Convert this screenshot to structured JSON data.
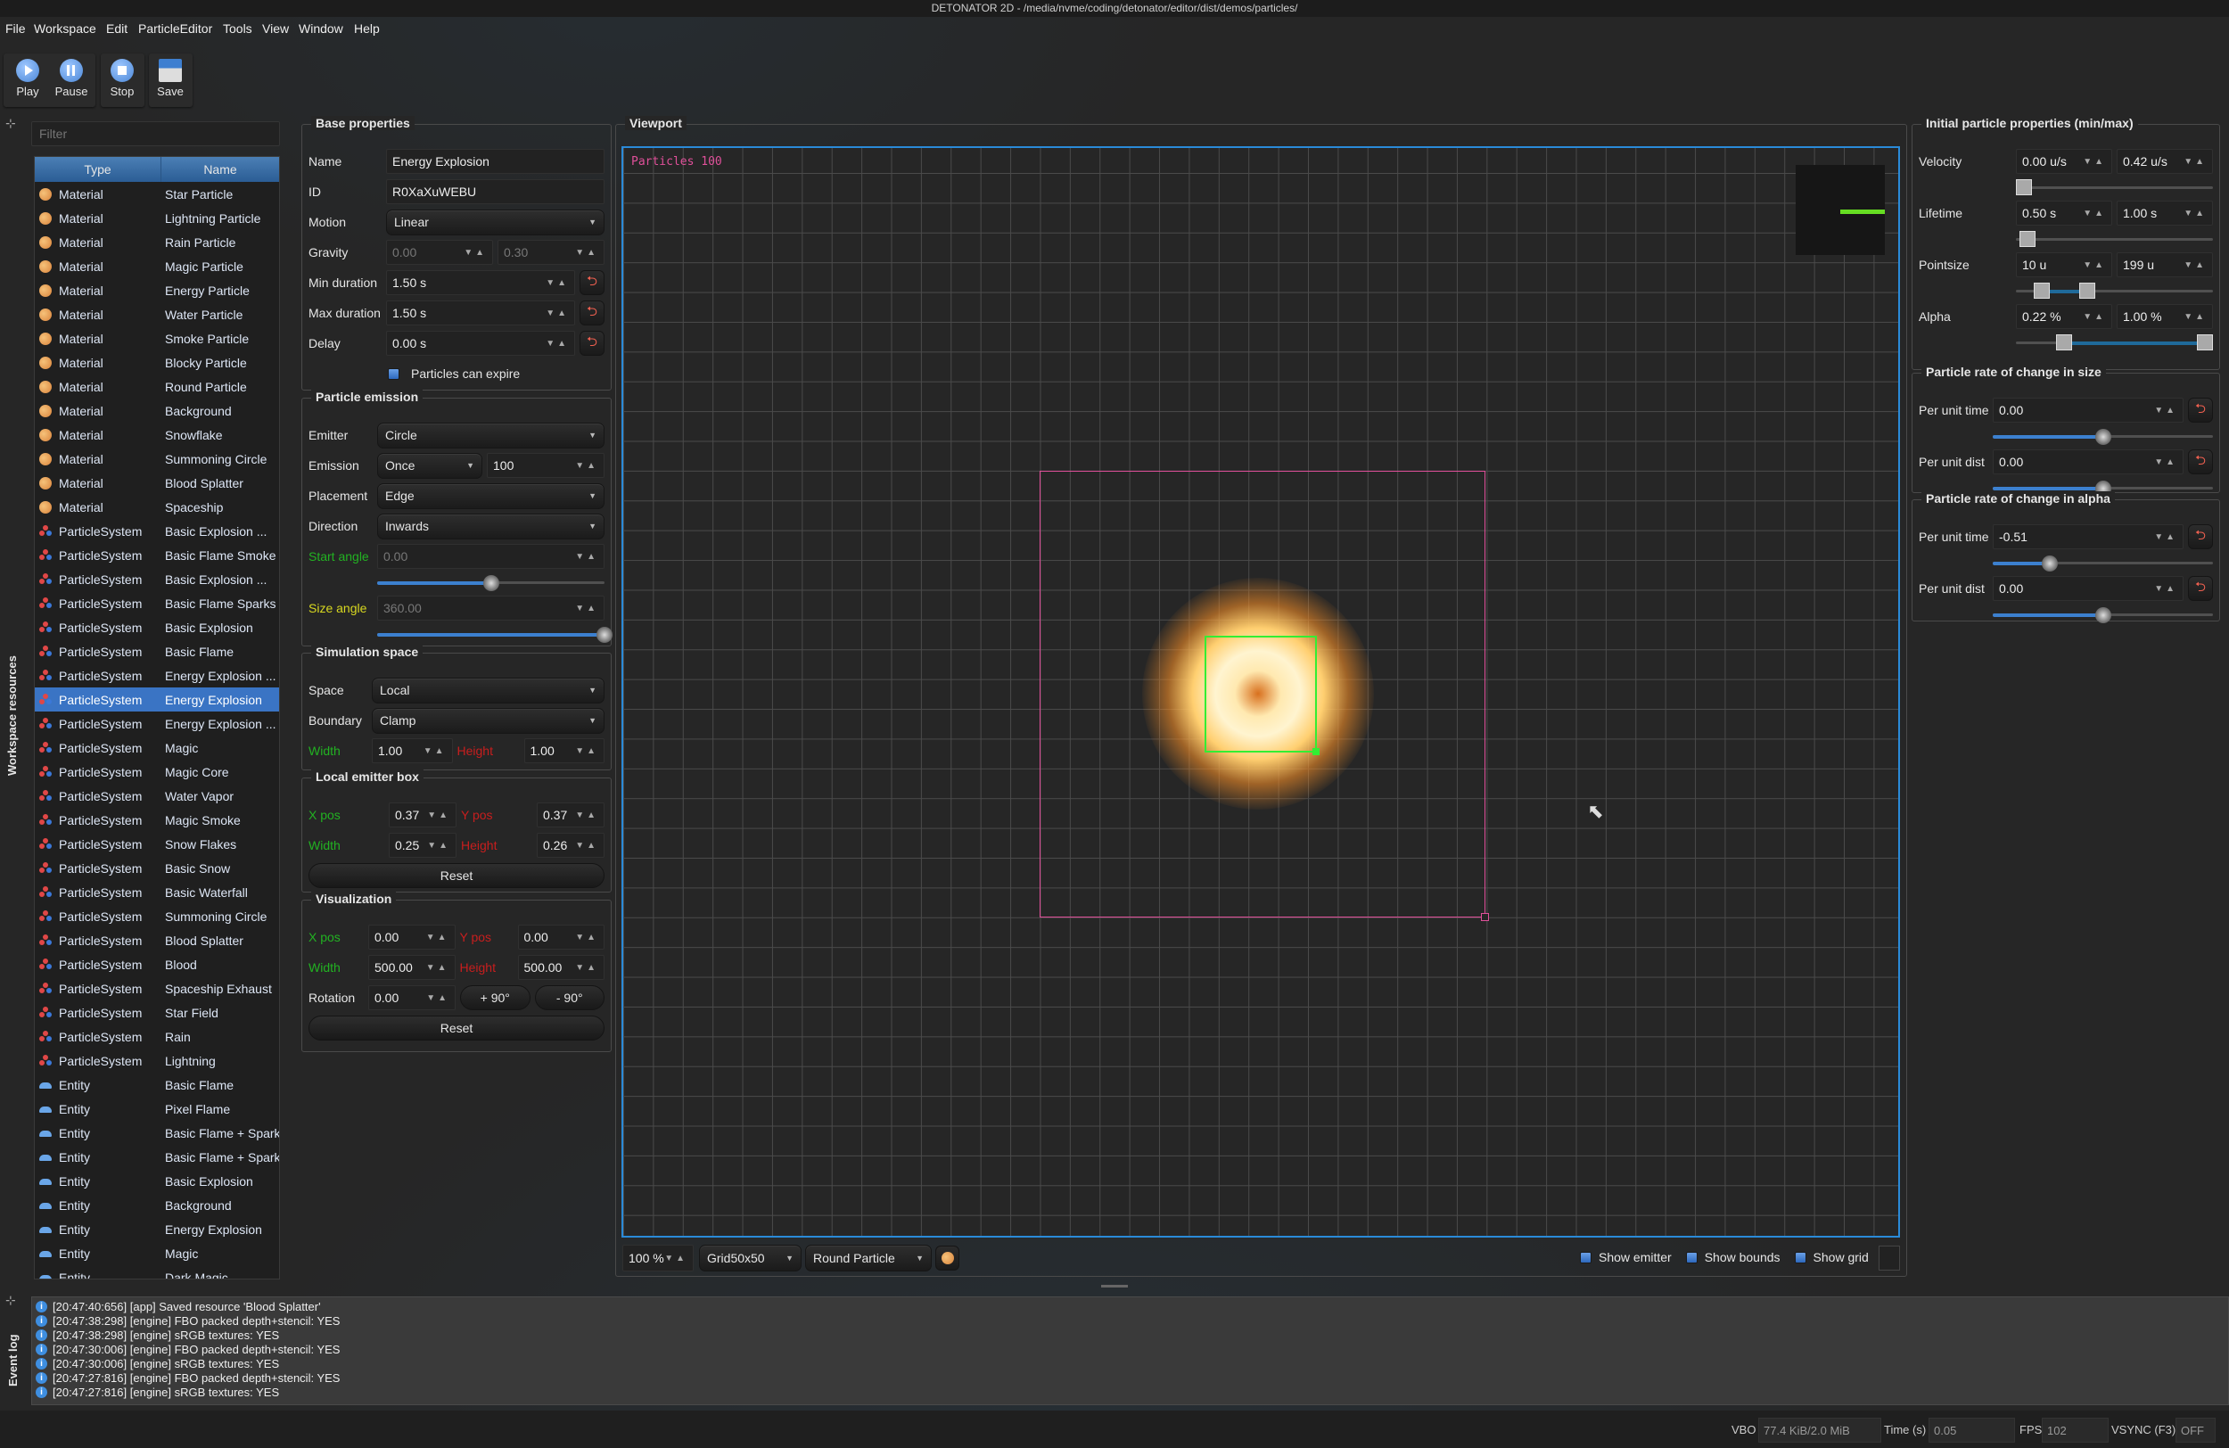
{
  "window_title": "DETONATOR 2D - /media/nvme/coding/detonator/editor/dist/demos/particles/",
  "menu": [
    "File",
    "Workspace",
    "Edit",
    "ParticleEditor",
    "Tools",
    "View",
    "Window",
    "Help"
  ],
  "toolbar": {
    "play": "Play",
    "pause": "Pause",
    "stop": "Stop",
    "save": "Save"
  },
  "resources": {
    "tab_label": "Workspace resources",
    "filter_placeholder": "Filter",
    "columns": [
      "Type",
      "Name"
    ],
    "selected_index": 21,
    "rows": [
      {
        "type": "Material",
        "name": "Star Particle"
      },
      {
        "type": "Material",
        "name": "Lightning Particle"
      },
      {
        "type": "Material",
        "name": "Rain Particle"
      },
      {
        "type": "Material",
        "name": "Magic Particle"
      },
      {
        "type": "Material",
        "name": "Energy Particle"
      },
      {
        "type": "Material",
        "name": "Water Particle"
      },
      {
        "type": "Material",
        "name": "Smoke Particle"
      },
      {
        "type": "Material",
        "name": "Blocky Particle"
      },
      {
        "type": "Material",
        "name": "Round Particle"
      },
      {
        "type": "Material",
        "name": "Background"
      },
      {
        "type": "Material",
        "name": "Snowflake"
      },
      {
        "type": "Material",
        "name": "Summoning Circle"
      },
      {
        "type": "Material",
        "name": "Blood Splatter"
      },
      {
        "type": "Material",
        "name": "Spaceship"
      },
      {
        "type": "ParticleSystem",
        "name": "Basic Explosion ..."
      },
      {
        "type": "ParticleSystem",
        "name": "Basic Flame Smoke"
      },
      {
        "type": "ParticleSystem",
        "name": "Basic Explosion ..."
      },
      {
        "type": "ParticleSystem",
        "name": "Basic Flame Sparks"
      },
      {
        "type": "ParticleSystem",
        "name": "Basic Explosion"
      },
      {
        "type": "ParticleSystem",
        "name": "Basic Flame"
      },
      {
        "type": "ParticleSystem",
        "name": "Energy Explosion ..."
      },
      {
        "type": "ParticleSystem",
        "name": "Energy Explosion"
      },
      {
        "type": "ParticleSystem",
        "name": "Energy Explosion ..."
      },
      {
        "type": "ParticleSystem",
        "name": "Magic"
      },
      {
        "type": "ParticleSystem",
        "name": "Magic Core"
      },
      {
        "type": "ParticleSystem",
        "name": "Water Vapor"
      },
      {
        "type": "ParticleSystem",
        "name": "Magic Smoke"
      },
      {
        "type": "ParticleSystem",
        "name": "Snow Flakes"
      },
      {
        "type": "ParticleSystem",
        "name": "Basic Snow"
      },
      {
        "type": "ParticleSystem",
        "name": "Basic Waterfall"
      },
      {
        "type": "ParticleSystem",
        "name": "Summoning Circle"
      },
      {
        "type": "ParticleSystem",
        "name": "Blood Splatter"
      },
      {
        "type": "ParticleSystem",
        "name": "Blood"
      },
      {
        "type": "ParticleSystem",
        "name": "Spaceship Exhaust"
      },
      {
        "type": "ParticleSystem",
        "name": "Star Field"
      },
      {
        "type": "ParticleSystem",
        "name": "Rain"
      },
      {
        "type": "ParticleSystem",
        "name": "Lightning"
      },
      {
        "type": "Entity",
        "name": "Basic Flame"
      },
      {
        "type": "Entity",
        "name": "Pixel Flame"
      },
      {
        "type": "Entity",
        "name": "Basic Flame + Spark.."
      },
      {
        "type": "Entity",
        "name": "Basic Flame + Sparks"
      },
      {
        "type": "Entity",
        "name": "Basic Explosion"
      },
      {
        "type": "Entity",
        "name": "Background"
      },
      {
        "type": "Entity",
        "name": "Energy Explosion"
      },
      {
        "type": "Entity",
        "name": "Magic"
      },
      {
        "type": "Entity",
        "name": "Dark Magic"
      }
    ]
  },
  "colors": {
    "x_label": "#22b222",
    "y_label": "#c81e1e",
    "size_angle_label": "#d8d820",
    "accent": "#2a8ad8",
    "emitter_bounds": "#e0509a",
    "emitter_box": "#33ee33"
  },
  "groups": {
    "base_properties": {
      "title": "Base properties",
      "rows": [
        {
          "kind": "text",
          "label": "Name",
          "value": "Energy Explosion"
        },
        {
          "kind": "text",
          "label": "ID",
          "value": "R0XaXuWEBU"
        },
        {
          "kind": "combo",
          "label": "Motion",
          "value": "Linear"
        },
        {
          "kind": "spin2",
          "label": "Gravity",
          "values": [
            "0.00",
            "0.30"
          ],
          "disabled": true
        },
        {
          "kind": "spin",
          "label": "Min duration",
          "value": "1.50 s",
          "reset": true
        },
        {
          "kind": "spin",
          "label": "Max duration",
          "value": "1.50 s",
          "reset": true
        },
        {
          "kind": "spin",
          "label": "Delay",
          "value": "0.00 s",
          "reset": true
        },
        {
          "kind": "check",
          "label": "Particles can expire",
          "checked": true
        }
      ]
    },
    "particle_emission": {
      "title": "Particle emission",
      "rows": [
        {
          "kind": "combo",
          "label": "Emitter",
          "value": "Circle"
        },
        {
          "kind": "combospin",
          "label": "Emission",
          "combo": "Once",
          "value": "100"
        },
        {
          "kind": "combo",
          "label": "Placement",
          "value": "Edge"
        },
        {
          "kind": "combo",
          "label": "Direction",
          "value": "Inwards"
        },
        {
          "kind": "spin",
          "label": "Start angle",
          "value": "0.00",
          "disabled": true,
          "color": "x_label"
        },
        {
          "kind": "slider",
          "style": "knob",
          "fraction": 0.5
        },
        {
          "kind": "spin",
          "label": "Size angle",
          "value": "360.00",
          "disabled": true,
          "color": "size_angle_label"
        },
        {
          "kind": "slider",
          "style": "knob",
          "fraction": 1.0
        }
      ]
    },
    "simulation_space": {
      "title": "Simulation space",
      "rows": [
        {
          "kind": "combo",
          "label": "Space",
          "value": "Local"
        },
        {
          "kind": "combo",
          "label": "Boundary",
          "value": "Clamp"
        },
        {
          "kind": "pair",
          "label": "Width",
          "value": "1.00",
          "label2": "Height",
          "value2": "1.00"
        }
      ]
    },
    "local_emitter_box": {
      "title": "Local emitter box",
      "rows": [
        {
          "kind": "pair",
          "label": "X pos",
          "value": "0.37",
          "label2": "Y pos",
          "value2": "0.37"
        },
        {
          "kind": "pair",
          "label": "Width",
          "value": "0.25",
          "label2": "Height",
          "value2": "0.26"
        },
        {
          "kind": "button",
          "label": "Reset"
        }
      ]
    },
    "visualization": {
      "title": "Visualization",
      "rows": [
        {
          "kind": "pair",
          "label": "X pos",
          "value": "0.00",
          "label2": "Y pos",
          "value2": "0.00"
        },
        {
          "kind": "pair",
          "label": "Width",
          "value": "500.00",
          "label2": "Height",
          "value2": "500.00"
        },
        {
          "kind": "spinbuttons",
          "label": "Rotation",
          "value": "0.00",
          "buttons": [
            "+ 90°",
            "- 90°"
          ]
        },
        {
          "kind": "button",
          "label": "Reset"
        }
      ]
    },
    "initial_particle_properties": {
      "title": "Initial particle properties (min/max)",
      "rows": [
        {
          "kind": "spin2",
          "label": "Velocity",
          "values": [
            "0.00 u/s",
            "0.42 u/s"
          ]
        },
        {
          "kind": "slider",
          "style": "range",
          "fraction": [
            0.0
          ]
        },
        {
          "kind": "spin2",
          "label": "Lifetime",
          "values": [
            "0.50 s",
            "1.00 s"
          ]
        },
        {
          "kind": "slider",
          "style": "range",
          "fraction": [
            0.02
          ]
        },
        {
          "kind": "spin2",
          "label": "Pointsize",
          "values": [
            "10 u",
            "199 u"
          ]
        },
        {
          "kind": "slider",
          "style": "range",
          "fraction": [
            0.1,
            0.35
          ]
        },
        {
          "kind": "spin2",
          "label": "Alpha",
          "values": [
            "0.22 %",
            "1.00 %"
          ]
        },
        {
          "kind": "slider",
          "style": "range",
          "fraction": [
            0.22,
            1.0
          ]
        }
      ]
    },
    "rate_size": {
      "title": "Particle rate of change in size",
      "rows": [
        {
          "kind": "spin",
          "label": "Per unit time",
          "value": "0.00",
          "reset": true
        },
        {
          "kind": "slider",
          "style": "knob",
          "fraction": 0.5
        },
        {
          "kind": "spin",
          "label": "Per unit dist",
          "value": "0.00",
          "reset": true
        },
        {
          "kind": "slider",
          "style": "knob",
          "fraction": 0.5
        }
      ]
    },
    "rate_alpha": {
      "title": "Particle rate of change in alpha",
      "rows": [
        {
          "kind": "spin",
          "label": "Per unit time",
          "value": "-0.51",
          "reset": true
        },
        {
          "kind": "slider",
          "style": "knob",
          "fraction": 0.26
        },
        {
          "kind": "spin",
          "label": "Per unit dist",
          "value": "0.00",
          "reset": true
        },
        {
          "kind": "slider",
          "style": "knob",
          "fraction": 0.5
        }
      ]
    }
  },
  "viewport": {
    "title": "Viewport",
    "particles_label": "Particles 100",
    "zoom": "100 %",
    "grid": "Grid50x50",
    "material": "Round Particle",
    "show_emitter": {
      "label": "Show emitter",
      "checked": true
    },
    "show_bounds": {
      "label": "Show bounds",
      "checked": true
    },
    "show_grid": {
      "label": "Show grid",
      "checked": true
    }
  },
  "event_log": {
    "tab_label": "Event log",
    "entries": [
      "[20:47:40:656] [app] Saved resource 'Blood Splatter'",
      "[20:47:38:298] [engine] FBO packed depth+stencil: YES",
      "[20:47:38:298] [engine] sRGB textures: YES",
      "[20:47:30:006] [engine] FBO packed depth+stencil: YES",
      "[20:47:30:006] [engine] sRGB textures: YES",
      "[20:47:27:816] [engine] FBO packed depth+stencil: YES",
      "[20:47:27:816] [engine] sRGB textures: YES"
    ]
  },
  "status": {
    "vbo_label": "VBO",
    "vbo": "77.4 KiB/2.0 MiB",
    "time_label": "Time (s)",
    "time": "0.05",
    "fps_label": "FPS",
    "fps": "102",
    "vsync_label": "VSYNC (F3)",
    "vsync": "OFF"
  }
}
